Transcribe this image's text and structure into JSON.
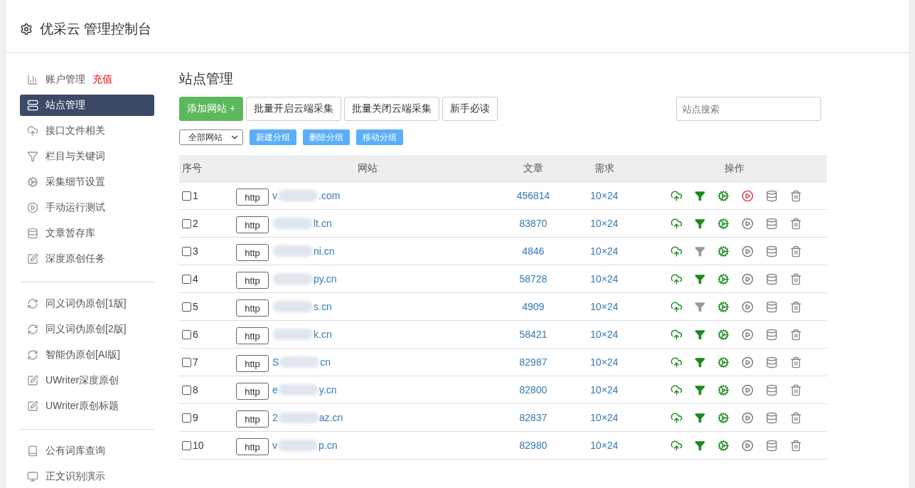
{
  "header": {
    "title": "优采云 管理控制台"
  },
  "sidebar": {
    "groups": [
      {
        "items": [
          {
            "label": "账户管理",
            "badge": "充值",
            "selected": false
          },
          {
            "label": "站点管理",
            "selected": true
          },
          {
            "label": "接口文件相关",
            "selected": false
          },
          {
            "label": "栏目与关键词",
            "selected": false
          },
          {
            "label": "采集细节设置",
            "selected": false
          },
          {
            "label": "手动运行测试",
            "selected": false
          },
          {
            "label": "文章暂存库",
            "selected": false
          },
          {
            "label": "深度原创任务",
            "selected": false
          }
        ]
      },
      {
        "items": [
          {
            "label": "同义词伪原创[1版]",
            "selected": false
          },
          {
            "label": "同义词伪原创[2版]",
            "selected": false
          },
          {
            "label": "智能伪原创[AI版]",
            "selected": false
          },
          {
            "label": "UWriter深度原创",
            "selected": false
          },
          {
            "label": "UWriter原创标题",
            "selected": false
          }
        ]
      },
      {
        "items": [
          {
            "label": "公有词库查询",
            "selected": false
          },
          {
            "label": "正文识别演示",
            "selected": false
          }
        ]
      }
    ]
  },
  "main": {
    "title": "站点管理",
    "actions": [
      {
        "label": "添加网站 +",
        "kind": "primary"
      },
      {
        "label": "批量开启云端采集",
        "kind": "default"
      },
      {
        "label": "批量关闭云端采集",
        "kind": "default"
      },
      {
        "label": "新手必读",
        "kind": "default"
      }
    ],
    "search": {
      "placeholder": "站点搜索"
    },
    "group_select": {
      "value": "全部网站"
    },
    "group_actions": [
      "新建分组",
      "删除分组",
      "移动分组"
    ],
    "table": {
      "columns": [
        "序号",
        "网站",
        "文章",
        "需求",
        "操作"
      ],
      "rows": [
        {
          "no": "1",
          "checked": false,
          "scheme": "http",
          "site_start": "v",
          "site_end": ".com",
          "articles": "456814",
          "demand": "10×24",
          "filter_on": true,
          "running": true
        },
        {
          "no": "2",
          "checked": false,
          "scheme": "http",
          "site_end": "lt.cn",
          "articles": "83870",
          "demand": "10×24",
          "filter_on": true,
          "running": false
        },
        {
          "no": "3",
          "checked": false,
          "scheme": "http",
          "site_end": "ni.cn",
          "articles": "4846",
          "demand": "10×24",
          "filter_on": false,
          "running": false
        },
        {
          "no": "4",
          "checked": false,
          "scheme": "http",
          "site_end": "py.cn",
          "articles": "58728",
          "demand": "10×24",
          "filter_on": true,
          "running": false
        },
        {
          "no": "5",
          "checked": false,
          "scheme": "http",
          "site_end": "s.cn",
          "articles": "4909",
          "demand": "10×24",
          "filter_on": false,
          "running": false
        },
        {
          "no": "6",
          "checked": false,
          "scheme": "http",
          "site_end": "k.cn",
          "articles": "58421",
          "demand": "10×24",
          "filter_on": true,
          "running": false
        },
        {
          "no": "7",
          "checked": false,
          "scheme": "http",
          "site_start": "S",
          "site_end": "cn",
          "articles": "82987",
          "demand": "10×24",
          "filter_on": true,
          "running": false
        },
        {
          "no": "8",
          "checked": false,
          "scheme": "http",
          "site_start": "e",
          "site_end": "y.cn",
          "articles": "82800",
          "demand": "10×24",
          "filter_on": true,
          "running": false
        },
        {
          "no": "9",
          "checked": false,
          "scheme": "http",
          "site_start": "2",
          "site_end": "az.cn",
          "articles": "82837",
          "demand": "10×24",
          "filter_on": true,
          "running": false
        },
        {
          "no": "10",
          "checked": false,
          "scheme": "http",
          "site_start": "v",
          "site_end": "p.cn",
          "articles": "82980",
          "demand": "10×24",
          "filter_on": true,
          "running": false
        }
      ]
    }
  }
}
